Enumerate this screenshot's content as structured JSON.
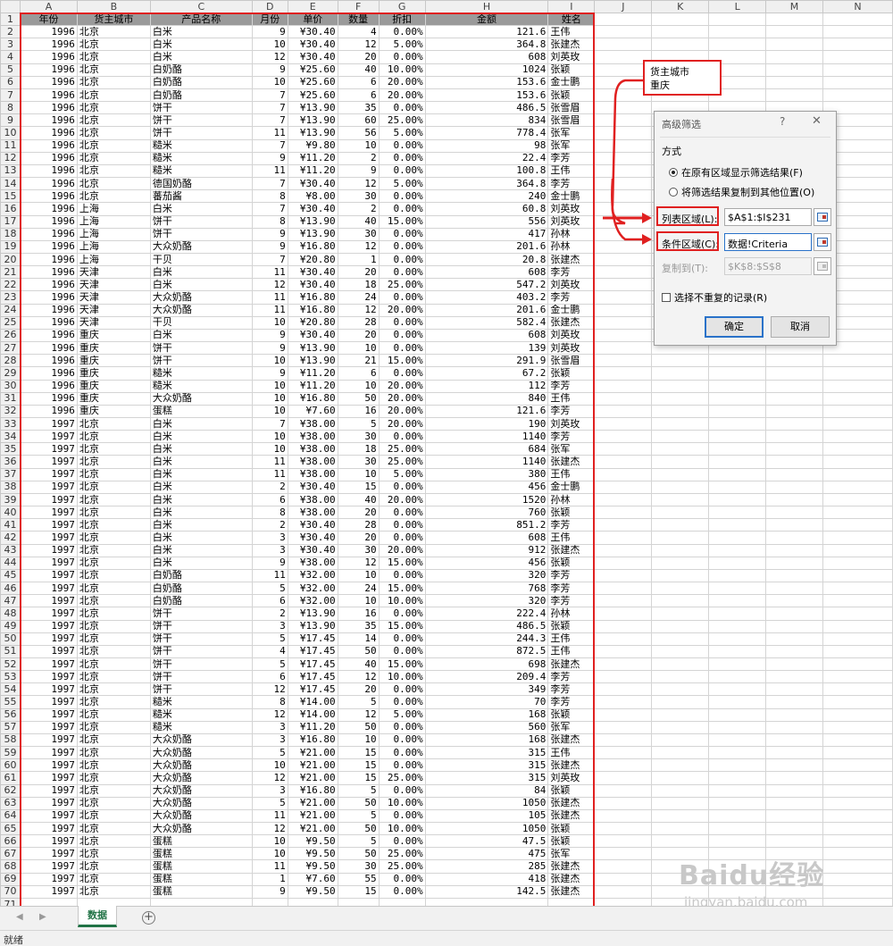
{
  "columns": [
    "A",
    "B",
    "C",
    "D",
    "E",
    "F",
    "G",
    "H",
    "I",
    "J",
    "K",
    "L",
    "M",
    "N"
  ],
  "header_row": [
    "年份",
    "货主城市",
    "产品名称",
    "月份",
    "单价",
    "数量",
    "折扣",
    "金额",
    "姓名"
  ],
  "rows": [
    [
      "1996",
      "北京",
      "白米",
      "9",
      "¥30.40",
      "4",
      "0.00%",
      "121.6",
      "王伟"
    ],
    [
      "1996",
      "北京",
      "白米",
      "10",
      "¥30.40",
      "12",
      "5.00%",
      "364.8",
      "张建杰"
    ],
    [
      "1996",
      "北京",
      "白米",
      "12",
      "¥30.40",
      "20",
      "0.00%",
      "608",
      "刘英玫"
    ],
    [
      "1996",
      "北京",
      "白奶酪",
      "9",
      "¥25.60",
      "40",
      "10.00%",
      "1024",
      "张颖"
    ],
    [
      "1996",
      "北京",
      "白奶酪",
      "10",
      "¥25.60",
      "6",
      "20.00%",
      "153.6",
      "金士鹏"
    ],
    [
      "1996",
      "北京",
      "白奶酪",
      "7",
      "¥25.60",
      "6",
      "20.00%",
      "153.6",
      "张颖"
    ],
    [
      "1996",
      "北京",
      "饼干",
      "7",
      "¥13.90",
      "35",
      "0.00%",
      "486.5",
      "张雪眉"
    ],
    [
      "1996",
      "北京",
      "饼干",
      "7",
      "¥13.90",
      "60",
      "25.00%",
      "834",
      "张雪眉"
    ],
    [
      "1996",
      "北京",
      "饼干",
      "11",
      "¥13.90",
      "56",
      "5.00%",
      "778.4",
      "张军"
    ],
    [
      "1996",
      "北京",
      "糙米",
      "7",
      "¥9.80",
      "10",
      "0.00%",
      "98",
      "张军"
    ],
    [
      "1996",
      "北京",
      "糙米",
      "9",
      "¥11.20",
      "2",
      "0.00%",
      "22.4",
      "李芳"
    ],
    [
      "1996",
      "北京",
      "糙米",
      "11",
      "¥11.20",
      "9",
      "0.00%",
      "100.8",
      "王伟"
    ],
    [
      "1996",
      "北京",
      "德国奶酪",
      "7",
      "¥30.40",
      "12",
      "5.00%",
      "364.8",
      "李芳"
    ],
    [
      "1996",
      "北京",
      "蕃茄酱",
      "8",
      "¥8.00",
      "30",
      "0.00%",
      "240",
      "金士鹏"
    ],
    [
      "1996",
      "上海",
      "白米",
      "7",
      "¥30.40",
      "2",
      "0.00%",
      "60.8",
      "刘英玫"
    ],
    [
      "1996",
      "上海",
      "饼干",
      "8",
      "¥13.90",
      "40",
      "15.00%",
      "556",
      "刘英玫"
    ],
    [
      "1996",
      "上海",
      "饼干",
      "9",
      "¥13.90",
      "30",
      "0.00%",
      "417",
      "孙林"
    ],
    [
      "1996",
      "上海",
      "大众奶酪",
      "9",
      "¥16.80",
      "12",
      "0.00%",
      "201.6",
      "孙林"
    ],
    [
      "1996",
      "上海",
      "干贝",
      "7",
      "¥20.80",
      "1",
      "0.00%",
      "20.8",
      "张建杰"
    ],
    [
      "1996",
      "天津",
      "白米",
      "11",
      "¥30.40",
      "20",
      "0.00%",
      "608",
      "李芳"
    ],
    [
      "1996",
      "天津",
      "白米",
      "12",
      "¥30.40",
      "18",
      "25.00%",
      "547.2",
      "刘英玫"
    ],
    [
      "1996",
      "天津",
      "大众奶酪",
      "11",
      "¥16.80",
      "24",
      "0.00%",
      "403.2",
      "李芳"
    ],
    [
      "1996",
      "天津",
      "大众奶酪",
      "11",
      "¥16.80",
      "12",
      "20.00%",
      "201.6",
      "金士鹏"
    ],
    [
      "1996",
      "天津",
      "干贝",
      "10",
      "¥20.80",
      "28",
      "0.00%",
      "582.4",
      "张建杰"
    ],
    [
      "1996",
      "重庆",
      "白米",
      "9",
      "¥30.40",
      "20",
      "0.00%",
      "608",
      "刘英玫"
    ],
    [
      "1996",
      "重庆",
      "饼干",
      "9",
      "¥13.90",
      "10",
      "0.00%",
      "139",
      "刘英玫"
    ],
    [
      "1996",
      "重庆",
      "饼干",
      "10",
      "¥13.90",
      "21",
      "15.00%",
      "291.9",
      "张雪眉"
    ],
    [
      "1996",
      "重庆",
      "糙米",
      "9",
      "¥11.20",
      "6",
      "0.00%",
      "67.2",
      "张颖"
    ],
    [
      "1996",
      "重庆",
      "糙米",
      "10",
      "¥11.20",
      "10",
      "20.00%",
      "112",
      "李芳"
    ],
    [
      "1996",
      "重庆",
      "大众奶酪",
      "10",
      "¥16.80",
      "50",
      "20.00%",
      "840",
      "王伟"
    ],
    [
      "1996",
      "重庆",
      "蛋糕",
      "10",
      "¥7.60",
      "16",
      "20.00%",
      "121.6",
      "李芳"
    ],
    [
      "1997",
      "北京",
      "白米",
      "7",
      "¥38.00",
      "5",
      "20.00%",
      "190",
      "刘英玫"
    ],
    [
      "1997",
      "北京",
      "白米",
      "10",
      "¥38.00",
      "30",
      "0.00%",
      "1140",
      "李芳"
    ],
    [
      "1997",
      "北京",
      "白米",
      "10",
      "¥38.00",
      "18",
      "25.00%",
      "684",
      "张军"
    ],
    [
      "1997",
      "北京",
      "白米",
      "11",
      "¥38.00",
      "30",
      "25.00%",
      "1140",
      "张建杰"
    ],
    [
      "1997",
      "北京",
      "白米",
      "11",
      "¥38.00",
      "10",
      "5.00%",
      "380",
      "王伟"
    ],
    [
      "1997",
      "北京",
      "白米",
      "2",
      "¥30.40",
      "15",
      "0.00%",
      "456",
      "金士鹏"
    ],
    [
      "1997",
      "北京",
      "白米",
      "6",
      "¥38.00",
      "40",
      "20.00%",
      "1520",
      "孙林"
    ],
    [
      "1997",
      "北京",
      "白米",
      "8",
      "¥38.00",
      "20",
      "0.00%",
      "760",
      "张颖"
    ],
    [
      "1997",
      "北京",
      "白米",
      "2",
      "¥30.40",
      "28",
      "0.00%",
      "851.2",
      "李芳"
    ],
    [
      "1997",
      "北京",
      "白米",
      "3",
      "¥30.40",
      "20",
      "0.00%",
      "608",
      "王伟"
    ],
    [
      "1997",
      "北京",
      "白米",
      "3",
      "¥30.40",
      "30",
      "20.00%",
      "912",
      "张建杰"
    ],
    [
      "1997",
      "北京",
      "白米",
      "9",
      "¥38.00",
      "12",
      "15.00%",
      "456",
      "张颖"
    ],
    [
      "1997",
      "北京",
      "白奶酪",
      "11",
      "¥32.00",
      "10",
      "0.00%",
      "320",
      "李芳"
    ],
    [
      "1997",
      "北京",
      "白奶酪",
      "5",
      "¥32.00",
      "24",
      "15.00%",
      "768",
      "李芳"
    ],
    [
      "1997",
      "北京",
      "白奶酪",
      "6",
      "¥32.00",
      "10",
      "10.00%",
      "320",
      "李芳"
    ],
    [
      "1997",
      "北京",
      "饼干",
      "2",
      "¥13.90",
      "16",
      "0.00%",
      "222.4",
      "孙林"
    ],
    [
      "1997",
      "北京",
      "饼干",
      "3",
      "¥13.90",
      "35",
      "15.00%",
      "486.5",
      "张颖"
    ],
    [
      "1997",
      "北京",
      "饼干",
      "5",
      "¥17.45",
      "14",
      "0.00%",
      "244.3",
      "王伟"
    ],
    [
      "1997",
      "北京",
      "饼干",
      "4",
      "¥17.45",
      "50",
      "0.00%",
      "872.5",
      "王伟"
    ],
    [
      "1997",
      "北京",
      "饼干",
      "5",
      "¥17.45",
      "40",
      "15.00%",
      "698",
      "张建杰"
    ],
    [
      "1997",
      "北京",
      "饼干",
      "6",
      "¥17.45",
      "12",
      "10.00%",
      "209.4",
      "李芳"
    ],
    [
      "1997",
      "北京",
      "饼干",
      "12",
      "¥17.45",
      "20",
      "0.00%",
      "349",
      "李芳"
    ],
    [
      "1997",
      "北京",
      "糙米",
      "8",
      "¥14.00",
      "5",
      "0.00%",
      "70",
      "李芳"
    ],
    [
      "1997",
      "北京",
      "糙米",
      "12",
      "¥14.00",
      "12",
      "5.00%",
      "168",
      "张颖"
    ],
    [
      "1997",
      "北京",
      "糙米",
      "3",
      "¥11.20",
      "50",
      "0.00%",
      "560",
      "张军"
    ],
    [
      "1997",
      "北京",
      "大众奶酪",
      "3",
      "¥16.80",
      "10",
      "0.00%",
      "168",
      "张建杰"
    ],
    [
      "1997",
      "北京",
      "大众奶酪",
      "5",
      "¥21.00",
      "15",
      "0.00%",
      "315",
      "王伟"
    ],
    [
      "1997",
      "北京",
      "大众奶酪",
      "10",
      "¥21.00",
      "15",
      "0.00%",
      "315",
      "张建杰"
    ],
    [
      "1997",
      "北京",
      "大众奶酪",
      "12",
      "¥21.00",
      "15",
      "25.00%",
      "315",
      "刘英玫"
    ],
    [
      "1997",
      "北京",
      "大众奶酪",
      "3",
      "¥16.80",
      "5",
      "0.00%",
      "84",
      "张颖"
    ],
    [
      "1997",
      "北京",
      "大众奶酪",
      "5",
      "¥21.00",
      "50",
      "10.00%",
      "1050",
      "张建杰"
    ],
    [
      "1997",
      "北京",
      "大众奶酪",
      "11",
      "¥21.00",
      "5",
      "0.00%",
      "105",
      "张建杰"
    ],
    [
      "1997",
      "北京",
      "大众奶酪",
      "12",
      "¥21.00",
      "50",
      "10.00%",
      "1050",
      "张颖"
    ],
    [
      "1997",
      "北京",
      "蛋糕",
      "10",
      "¥9.50",
      "5",
      "0.00%",
      "47.5",
      "张颖"
    ],
    [
      "1997",
      "北京",
      "蛋糕",
      "10",
      "¥9.50",
      "50",
      "25.00%",
      "475",
      "张军"
    ],
    [
      "1997",
      "北京",
      "蛋糕",
      "11",
      "¥9.50",
      "30",
      "25.00%",
      "285",
      "张建杰"
    ],
    [
      "1997",
      "北京",
      "蛋糕",
      "1",
      "¥7.60",
      "55",
      "0.00%",
      "418",
      "张建杰"
    ],
    [
      "1997",
      "北京",
      "蛋糕",
      "9",
      "¥9.50",
      "15",
      "0.00%",
      "142.5",
      "张建杰"
    ]
  ],
  "criteria": {
    "header": "货主城市",
    "value": "重庆"
  },
  "dialog": {
    "title": "高级筛选",
    "help": "?",
    "close": "✕",
    "method_label": "方式",
    "option1": "在原有区域显示筛选结果(F)",
    "option2": "将筛选结果复制到其他位置(O)",
    "list_range_label": "列表区域(L):",
    "list_range_value": "$A$1:$I$231",
    "criteria_range_label": "条件区域(C):",
    "criteria_range_value": "数据!Criteria",
    "copy_to_label": "复制到(T):",
    "copy_to_value": "$K$8:$S$8",
    "unique_label": "选择不重复的记录(R)",
    "ok": "确定",
    "cancel": "取消"
  },
  "sheet_tab": "数据",
  "add_sheet": "+",
  "status": "就绪",
  "watermark": {
    "logo": "Baidu经验",
    "url": "jingyan.baidu.com"
  },
  "accent_red": "#e02020",
  "excel_green": "#217346"
}
